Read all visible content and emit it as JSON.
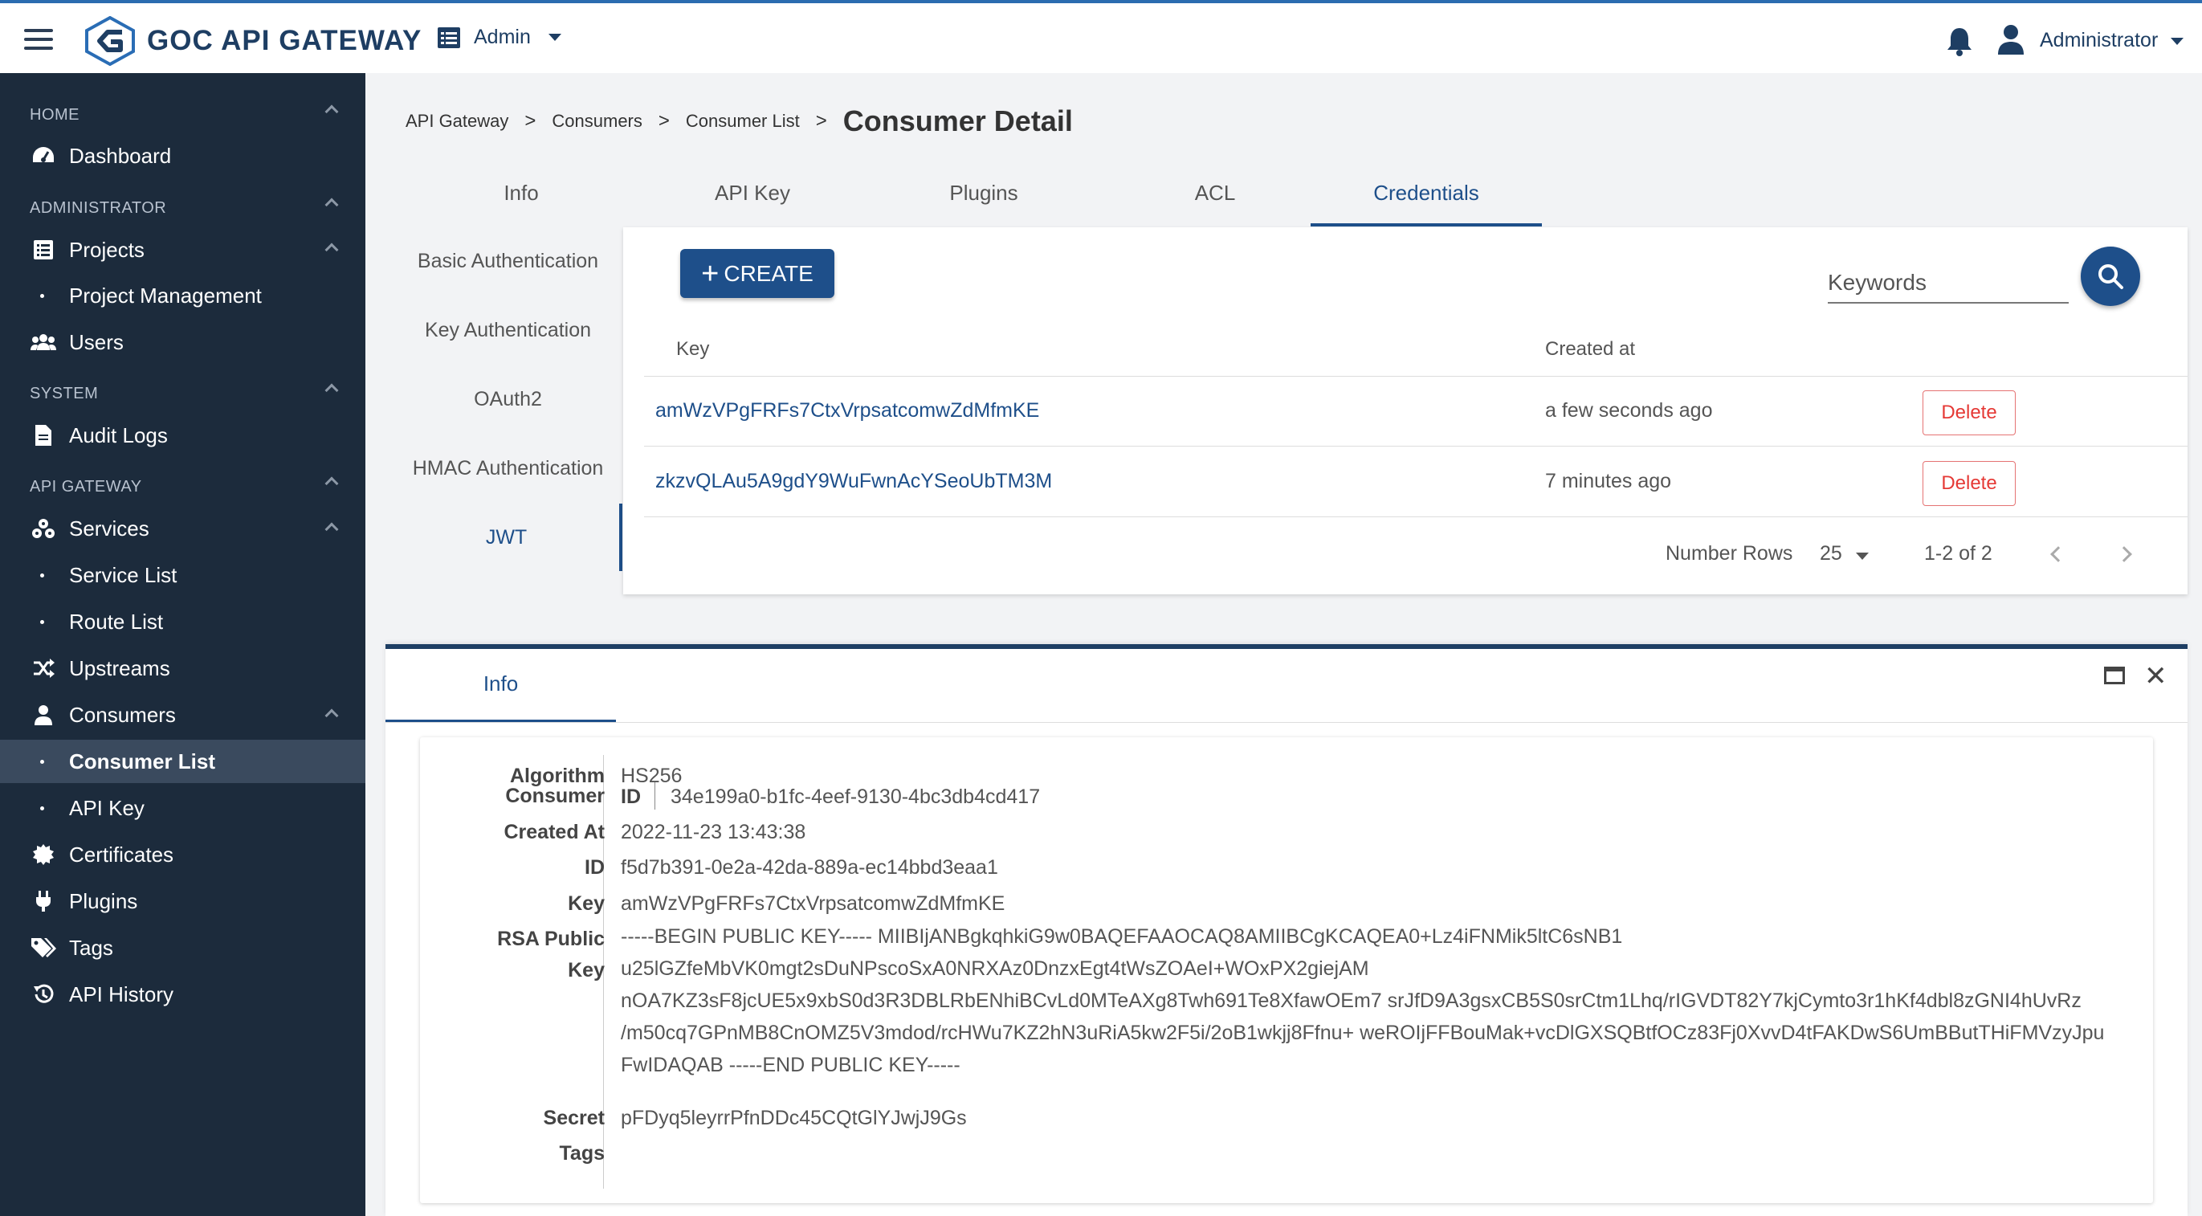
{
  "header": {
    "brand": "GOC API GATEWAY",
    "admin_menu": "Admin",
    "user": "Administrator"
  },
  "sidebar": {
    "sections": {
      "home": "HOME",
      "administrator": "ADMINISTRATOR",
      "system": "SYSTEM",
      "api_gateway": "API GATEWAY"
    },
    "items": {
      "dashboard": "Dashboard",
      "projects": "Projects",
      "project_management": "Project Management",
      "users": "Users",
      "audit_logs": "Audit Logs",
      "services": "Services",
      "service_list": "Service List",
      "route_list": "Route List",
      "upstreams": "Upstreams",
      "consumers": "Consumers",
      "consumer_list": "Consumer List",
      "api_key": "API Key",
      "certificates": "Certificates",
      "plugins": "Plugins",
      "tags": "Tags",
      "api_history": "API History"
    }
  },
  "breadcrumb": {
    "items": [
      "API Gateway",
      "Consumers",
      "Consumer List"
    ],
    "separator": ">",
    "title": "Consumer Detail"
  },
  "tabs": [
    "Info",
    "API Key",
    "Plugins",
    "ACL",
    "Credentials"
  ],
  "active_tab": "Credentials",
  "subtabs": [
    "Basic Authentication",
    "Key Authentication",
    "OAuth2",
    "HMAC Authentication",
    "JWT"
  ],
  "active_subtab": "JWT",
  "toolbar": {
    "create_label": "CREATE",
    "search_placeholder": "Keywords"
  },
  "table": {
    "columns": [
      "Key",
      "Created at"
    ],
    "rows": [
      {
        "key": "amWzVPgFRFs7CtxVrpsatcomwZdMfmKE",
        "created": "a few seconds ago",
        "action": "Delete"
      },
      {
        "key": "zkzvQLAu5A9gdY9WuFwnAcYSeoUbTM3M",
        "created": "7 minutes ago",
        "action": "Delete"
      }
    ]
  },
  "pagination": {
    "rows_label": "Number Rows",
    "rows_value": "25",
    "range": "1-2 of 2"
  },
  "detail": {
    "tab": "Info",
    "fields": {
      "algorithm_label": "Algorithm",
      "algorithm": "HS256",
      "consumer_label": "Consumer",
      "consumer_id_label": "ID",
      "consumer_id": "34e199a0-b1fc-4eef-9130-4bc3db4cd417",
      "created_at_label": "Created At",
      "created_at": "2022-11-23 13:43:38",
      "id_label": "ID",
      "id": "f5d7b391-0e2a-42da-889a-ec14bbd3eaa1",
      "key_label": "Key",
      "key": "amWzVPgFRFs7CtxVrpsatcomwZdMfmKE",
      "rsa_label_1": "RSA Public",
      "rsa_label_2": "Key",
      "rsa_public_key": "-----BEGIN PUBLIC KEY----- MIIBIjANBgkqhkiG9w0BAQEFAAOCAQ8AMIIBCgKCAQEA0+Lz4iFNMik5ltC6sNB1 u25lGZfeMbVK0mgt2sDuNPscoSxA0NRXAz0DnzxEgt4tWsZOAeI+WOxPX2giejAM nOA7KZ3sF8jcUE5x9xbS0d3R3DBLRbENhiBCvLd0MTeAXg8Twh691Te8XfawOEm7 srJfD9A3gsxCB5S0srCtm1Lhq/rIGVDT82Y7kjCymto3r1hKf4dbl8zGNI4hUvRz /m50cq7GPnMB8CnOMZ5V3mdod/rcHWu7KZ2hN3uRiA5kw2F5i/2oB1wkjj8Ffnu+ weROIjFFBouMak+vcDlGXSQBtfOCz83Fj0XvvD4tFAKDwS6UmBButTHiFMVzyJpu FwIDAQAB -----END PUBLIC KEY-----",
      "secret_label": "Secret",
      "secret": "pFDyq5leyrrPfnDDc45CQtGlYJwjJ9Gs",
      "tags_label": "Tags"
    }
  }
}
